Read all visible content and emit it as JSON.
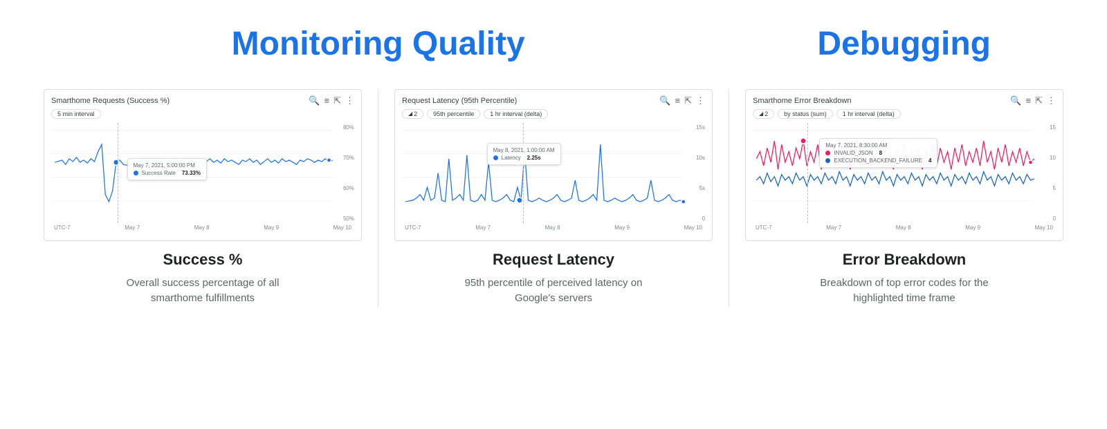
{
  "page": {
    "left_title": "Monitoring Quality",
    "right_title": "Debugging",
    "sections": [
      {
        "id": "success",
        "chart_title": "Smarthome Requests (Success %)",
        "filters": [
          "5 min interval"
        ],
        "filter_has_icon": [
          false
        ],
        "x_labels": [
          "UTC-7",
          "May 7",
          "May 8",
          "May 9",
          "May 10"
        ],
        "y_labels": [
          "80%",
          "70%",
          "60%",
          "50%"
        ],
        "tooltip_date": "May 7, 2021, 5:00:00 PM",
        "tooltip_metric": "Success Rate",
        "tooltip_value": "73.33%",
        "tooltip_dot_color": "#1a73e8",
        "line_color": "#1a73e8",
        "subtitle": "Success %",
        "description": "Overall success percentage of all smarthome fulfillments"
      },
      {
        "id": "latency",
        "chart_title": "Request Latency (95th Percentile)",
        "filters": [
          "2",
          "95th percentile",
          "1 hr interval (delta)"
        ],
        "filter_has_icon": [
          true,
          false,
          false
        ],
        "x_labels": [
          "UTC-7",
          "May 7",
          "May 8",
          "May 9",
          "May 10"
        ],
        "y_labels": [
          "15s",
          "10s",
          "5s",
          "0"
        ],
        "tooltip_date": "May 8, 2021, 1:00:00 AM",
        "tooltip_metric": "Latency",
        "tooltip_value": "2.25s",
        "tooltip_dot_color": "#1a73e8",
        "line_color": "#1a73e8",
        "subtitle": "Request Latency",
        "description": "95th percentile of perceived latency on Google's servers"
      },
      {
        "id": "error",
        "chart_title": "Smarthome Error Breakdown",
        "filters": [
          "2",
          "by status (sum)",
          "1 hr interval (delta)"
        ],
        "filter_has_icon": [
          true,
          false,
          false
        ],
        "x_labels": [
          "UTC-7",
          "May 7",
          "May 8",
          "May 9",
          "May 10"
        ],
        "y_labels": [
          "15",
          "10",
          "5",
          "0"
        ],
        "tooltip_date": "May 7, 2021, 8:30:00 AM",
        "tooltip_rows": [
          {
            "label": "INVALID_JSON",
            "value": "8",
            "color": "#e91e63"
          },
          {
            "label": "EXECUTION_BACKEND_FAILURE",
            "value": "4",
            "color": "#1565c0"
          }
        ],
        "line_color": "#e91e63",
        "line_color2": "#1565c0",
        "subtitle": "Error Breakdown",
        "description": "Breakdown of top error codes for the highlighted time frame"
      }
    ]
  }
}
